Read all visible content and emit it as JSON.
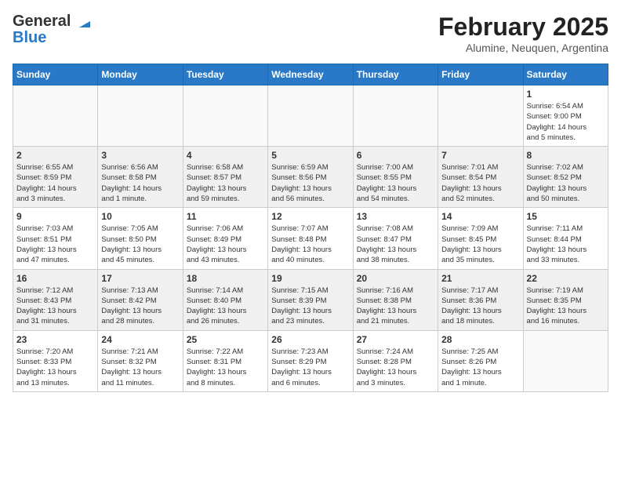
{
  "header": {
    "logo_line1": "General",
    "logo_line2": "Blue",
    "month_title": "February 2025",
    "location": "Alumine, Neuquen, Argentina"
  },
  "days_of_week": [
    "Sunday",
    "Monday",
    "Tuesday",
    "Wednesday",
    "Thursday",
    "Friday",
    "Saturday"
  ],
  "weeks": [
    [
      {
        "day": "",
        "info": ""
      },
      {
        "day": "",
        "info": ""
      },
      {
        "day": "",
        "info": ""
      },
      {
        "day": "",
        "info": ""
      },
      {
        "day": "",
        "info": ""
      },
      {
        "day": "",
        "info": ""
      },
      {
        "day": "1",
        "info": "Sunrise: 6:54 AM\nSunset: 9:00 PM\nDaylight: 14 hours\nand 5 minutes."
      }
    ],
    [
      {
        "day": "2",
        "info": "Sunrise: 6:55 AM\nSunset: 8:59 PM\nDaylight: 14 hours\nand 3 minutes."
      },
      {
        "day": "3",
        "info": "Sunrise: 6:56 AM\nSunset: 8:58 PM\nDaylight: 14 hours\nand 1 minute."
      },
      {
        "day": "4",
        "info": "Sunrise: 6:58 AM\nSunset: 8:57 PM\nDaylight: 13 hours\nand 59 minutes."
      },
      {
        "day": "5",
        "info": "Sunrise: 6:59 AM\nSunset: 8:56 PM\nDaylight: 13 hours\nand 56 minutes."
      },
      {
        "day": "6",
        "info": "Sunrise: 7:00 AM\nSunset: 8:55 PM\nDaylight: 13 hours\nand 54 minutes."
      },
      {
        "day": "7",
        "info": "Sunrise: 7:01 AM\nSunset: 8:54 PM\nDaylight: 13 hours\nand 52 minutes."
      },
      {
        "day": "8",
        "info": "Sunrise: 7:02 AM\nSunset: 8:52 PM\nDaylight: 13 hours\nand 50 minutes."
      }
    ],
    [
      {
        "day": "9",
        "info": "Sunrise: 7:03 AM\nSunset: 8:51 PM\nDaylight: 13 hours\nand 47 minutes."
      },
      {
        "day": "10",
        "info": "Sunrise: 7:05 AM\nSunset: 8:50 PM\nDaylight: 13 hours\nand 45 minutes."
      },
      {
        "day": "11",
        "info": "Sunrise: 7:06 AM\nSunset: 8:49 PM\nDaylight: 13 hours\nand 43 minutes."
      },
      {
        "day": "12",
        "info": "Sunrise: 7:07 AM\nSunset: 8:48 PM\nDaylight: 13 hours\nand 40 minutes."
      },
      {
        "day": "13",
        "info": "Sunrise: 7:08 AM\nSunset: 8:47 PM\nDaylight: 13 hours\nand 38 minutes."
      },
      {
        "day": "14",
        "info": "Sunrise: 7:09 AM\nSunset: 8:45 PM\nDaylight: 13 hours\nand 35 minutes."
      },
      {
        "day": "15",
        "info": "Sunrise: 7:11 AM\nSunset: 8:44 PM\nDaylight: 13 hours\nand 33 minutes."
      }
    ],
    [
      {
        "day": "16",
        "info": "Sunrise: 7:12 AM\nSunset: 8:43 PM\nDaylight: 13 hours\nand 31 minutes."
      },
      {
        "day": "17",
        "info": "Sunrise: 7:13 AM\nSunset: 8:42 PM\nDaylight: 13 hours\nand 28 minutes."
      },
      {
        "day": "18",
        "info": "Sunrise: 7:14 AM\nSunset: 8:40 PM\nDaylight: 13 hours\nand 26 minutes."
      },
      {
        "day": "19",
        "info": "Sunrise: 7:15 AM\nSunset: 8:39 PM\nDaylight: 13 hours\nand 23 minutes."
      },
      {
        "day": "20",
        "info": "Sunrise: 7:16 AM\nSunset: 8:38 PM\nDaylight: 13 hours\nand 21 minutes."
      },
      {
        "day": "21",
        "info": "Sunrise: 7:17 AM\nSunset: 8:36 PM\nDaylight: 13 hours\nand 18 minutes."
      },
      {
        "day": "22",
        "info": "Sunrise: 7:19 AM\nSunset: 8:35 PM\nDaylight: 13 hours\nand 16 minutes."
      }
    ],
    [
      {
        "day": "23",
        "info": "Sunrise: 7:20 AM\nSunset: 8:33 PM\nDaylight: 13 hours\nand 13 minutes."
      },
      {
        "day": "24",
        "info": "Sunrise: 7:21 AM\nSunset: 8:32 PM\nDaylight: 13 hours\nand 11 minutes."
      },
      {
        "day": "25",
        "info": "Sunrise: 7:22 AM\nSunset: 8:31 PM\nDaylight: 13 hours\nand 8 minutes."
      },
      {
        "day": "26",
        "info": "Sunrise: 7:23 AM\nSunset: 8:29 PM\nDaylight: 13 hours\nand 6 minutes."
      },
      {
        "day": "27",
        "info": "Sunrise: 7:24 AM\nSunset: 8:28 PM\nDaylight: 13 hours\nand 3 minutes."
      },
      {
        "day": "28",
        "info": "Sunrise: 7:25 AM\nSunset: 8:26 PM\nDaylight: 13 hours\nand 1 minute."
      },
      {
        "day": "",
        "info": ""
      }
    ]
  ]
}
